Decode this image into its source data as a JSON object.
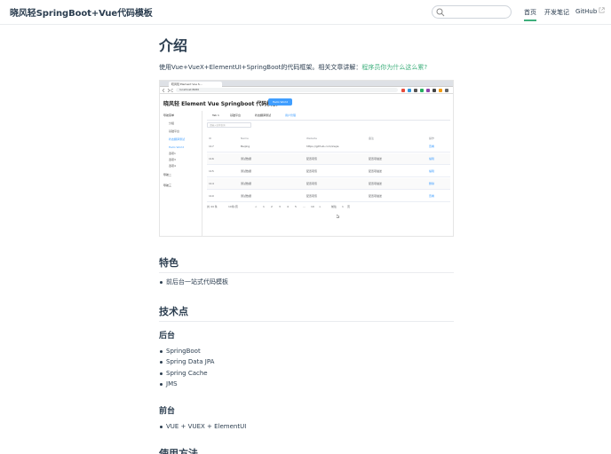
{
  "navbar": {
    "site_name": "晓风轻SpringBoot+Vue代码模板",
    "search_placeholder": "",
    "links": [
      {
        "label": "首页",
        "active": true
      },
      {
        "label": "开发笔记",
        "active": false
      },
      {
        "label": "GitHub",
        "active": false,
        "external": true
      }
    ]
  },
  "content": {
    "title": "介绍",
    "intro_text": "使用Vue+VueX+ElementUI+SpringBoot的代码框架。相关文章讲解：",
    "intro_link": "程序员你为什么这么累?",
    "screenshot": {
      "browser_tab": "晓风轻 Element Vue S...",
      "url": "localhost:8080",
      "app_title": "晓风轻 Element Vue Springboot 代码模板",
      "app_button": "Hello World",
      "sidebar": [
        {
          "label": "导航菜单",
          "type": "item"
        },
        {
          "label": "分组",
          "type": "sub"
        },
        {
          "label": "基础平台",
          "type": "sub"
        },
        {
          "label": "状态翻译测试",
          "type": "sub-blue"
        },
        {
          "label": "Hello World",
          "type": "sub-blue"
        },
        {
          "label": "选项1",
          "type": "sub"
        },
        {
          "label": "选项3",
          "type": "sub"
        },
        {
          "label": "选项4",
          "type": "sub"
        },
        {
          "label": "导航二",
          "type": "item"
        },
        {
          "label": "导航三",
          "type": "item"
        }
      ],
      "tabs": [
        "Tab 1",
        "基础平台",
        "状态翻译测试",
        "用户管理"
      ],
      "filter_placeholder": "请输入名称查询",
      "columns": [
        "ID",
        "Name",
        "Website",
        "备注",
        "操作"
      ],
      "rows": [
        [
          "117",
          "Beijing",
          "https://github.com/xwjie",
          "",
          "查看"
        ],
        [
          "116",
          "测试数据",
          "配置项值",
          "配置项描述",
          "编辑"
        ],
        [
          "115",
          "测试数据",
          "配置项值",
          "配置项描述",
          "编辑"
        ],
        [
          "114",
          "测试数据",
          "配置项值",
          "配置项描述",
          "删除"
        ],
        [
          "110",
          "测试数据",
          "配置项值",
          "配置项描述",
          "查看"
        ]
      ],
      "pager": {
        "total": "共 44 条",
        "size": "10条/页",
        "pages": [
          "<",
          "1",
          "2",
          "3",
          "4",
          "5",
          "...",
          "10",
          ">"
        ],
        "goto": "前往",
        "page_input": "1",
        "page_unit": "页"
      }
    },
    "features_heading": "特色",
    "features": [
      "前后台一站式代码模板"
    ],
    "tech_heading": "技术点",
    "backend_heading": "后台",
    "backend": [
      "SpringBoot",
      "Spring Data JPA",
      "Spring Cache",
      "JMS"
    ],
    "frontend_heading": "前台",
    "frontend": [
      "VUE + VUEX + ElementUI"
    ],
    "usage_heading": "使用方法"
  },
  "colors": {
    "accent": "#3eaf7c",
    "text": "#2c3e50",
    "element_blue": "#409eff"
  }
}
